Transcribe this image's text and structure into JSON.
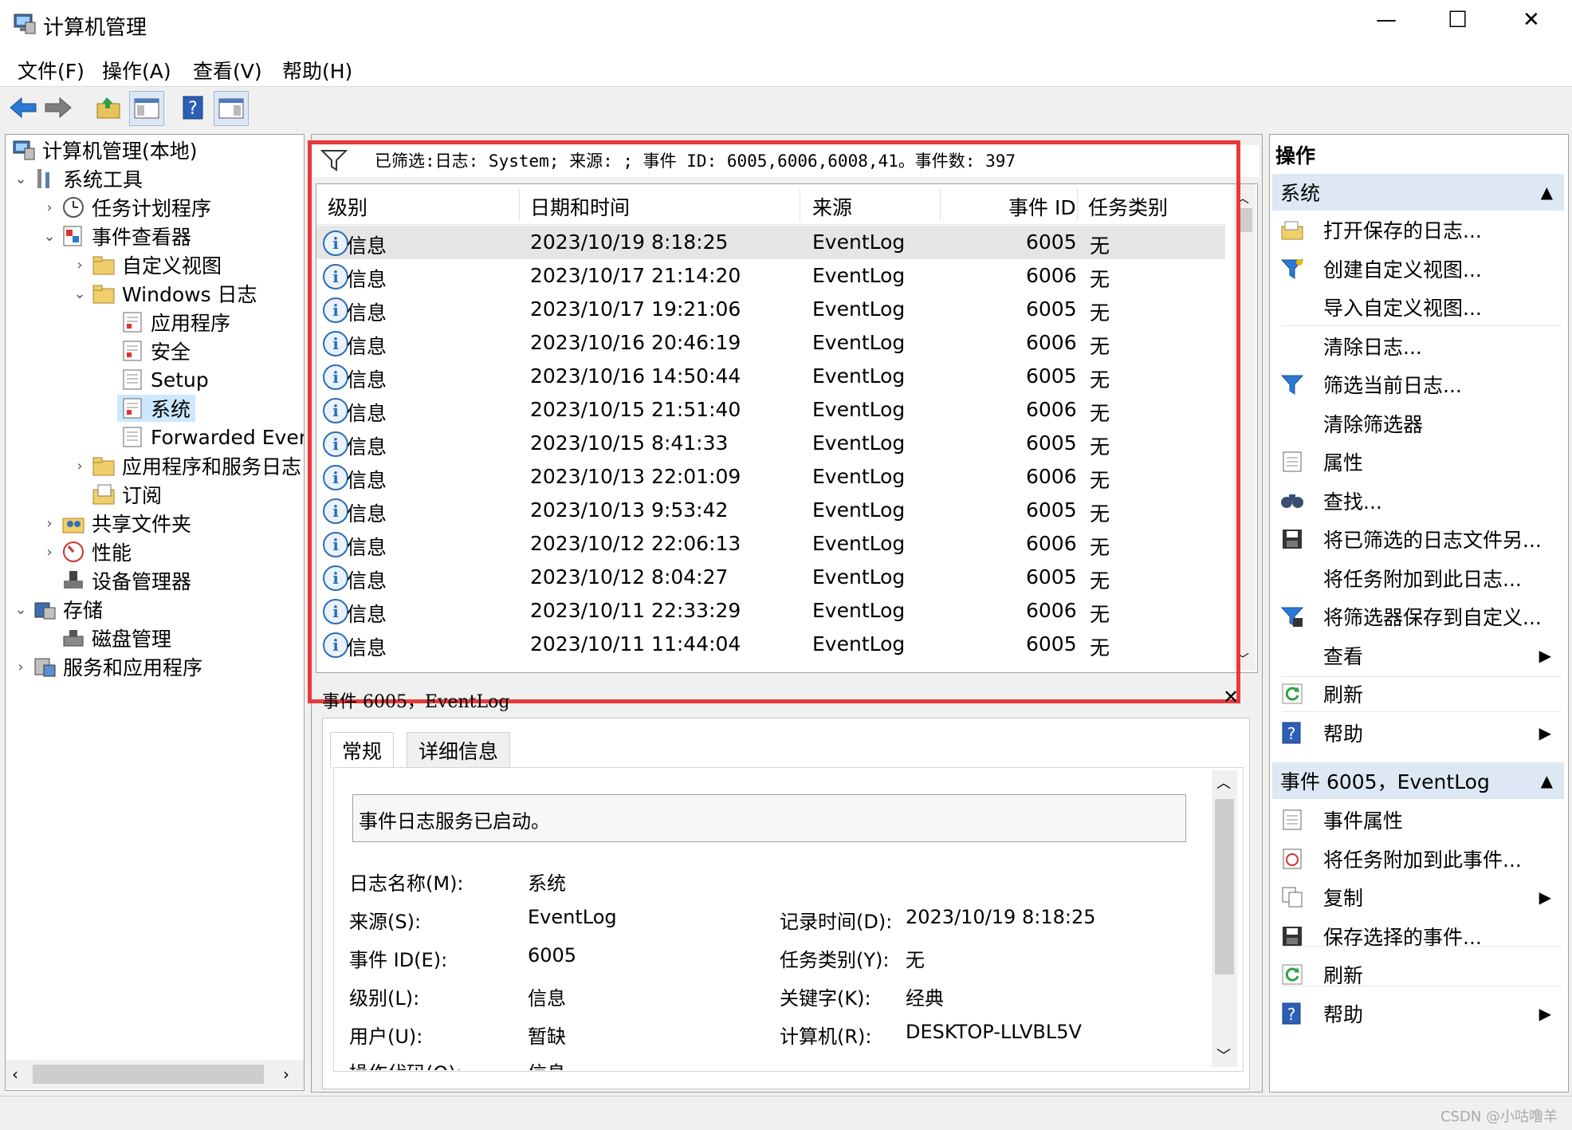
{
  "window": {
    "title": "计算机管理",
    "controls": {
      "minimize": "—",
      "maximize": "☐",
      "close": "✕"
    }
  },
  "menu": [
    "文件(F)",
    "操作(A)",
    "查看(V)",
    "帮助(H)"
  ],
  "toolbar": [
    "back-icon",
    "forward-icon",
    "up-folder-icon",
    "show-hide-tree-icon",
    "help-icon",
    "show-hide-action-icon"
  ],
  "tree": [
    {
      "label": "计算机管理(本地)",
      "icon": "computer-management-icon"
    },
    {
      "label": "系统工具",
      "icon": "tools-icon"
    },
    {
      "label": "任务计划程序",
      "icon": "clock-icon"
    },
    {
      "label": "事件查看器",
      "icon": "event-viewer-icon"
    },
    {
      "label": "自定义视图",
      "icon": "folder-icon"
    },
    {
      "label": "Windows 日志",
      "icon": "folder-icon"
    },
    {
      "label": "应用程序",
      "icon": "log-icon"
    },
    {
      "label": "安全",
      "icon": "log-icon"
    },
    {
      "label": "Setup",
      "icon": "log-icon"
    },
    {
      "label": "系统",
      "icon": "log-icon"
    },
    {
      "label": "Forwarded Even",
      "icon": "log-icon"
    },
    {
      "label": "应用程序和服务日志",
      "icon": "folder-icon"
    },
    {
      "label": "订阅",
      "icon": "subscription-icon"
    },
    {
      "label": "共享文件夹",
      "icon": "shared-folder-icon"
    },
    {
      "label": "性能",
      "icon": "performance-icon"
    },
    {
      "label": "设备管理器",
      "icon": "device-manager-icon"
    },
    {
      "label": "存储",
      "icon": "storage-icon"
    },
    {
      "label": "磁盘管理",
      "icon": "disk-icon"
    },
    {
      "label": "服务和应用程序",
      "icon": "services-icon"
    }
  ],
  "filter": {
    "text": "已筛选:日志: System; 来源: ; 事件 ID: 6005,6006,6008,41。事件数: 397"
  },
  "grid": {
    "headers": [
      "级别",
      "日期和时间",
      "来源",
      "事件 ID",
      "任务类别"
    ],
    "rows": [
      {
        "level": "信息",
        "datetime": "2023/10/19 8:18:25",
        "source": "EventLog",
        "id": "6005",
        "task": "无"
      },
      {
        "level": "信息",
        "datetime": "2023/10/17 21:14:20",
        "source": "EventLog",
        "id": "6006",
        "task": "无"
      },
      {
        "level": "信息",
        "datetime": "2023/10/17 19:21:06",
        "source": "EventLog",
        "id": "6005",
        "task": "无"
      },
      {
        "level": "信息",
        "datetime": "2023/10/16 20:46:19",
        "source": "EventLog",
        "id": "6006",
        "task": "无"
      },
      {
        "level": "信息",
        "datetime": "2023/10/16 14:50:44",
        "source": "EventLog",
        "id": "6005",
        "task": "无"
      },
      {
        "level": "信息",
        "datetime": "2023/10/15 21:51:40",
        "source": "EventLog",
        "id": "6006",
        "task": "无"
      },
      {
        "level": "信息",
        "datetime": "2023/10/15 8:41:33",
        "source": "EventLog",
        "id": "6005",
        "task": "无"
      },
      {
        "level": "信息",
        "datetime": "2023/10/13 22:01:09",
        "source": "EventLog",
        "id": "6006",
        "task": "无"
      },
      {
        "level": "信息",
        "datetime": "2023/10/13 9:53:42",
        "source": "EventLog",
        "id": "6005",
        "task": "无"
      },
      {
        "level": "信息",
        "datetime": "2023/10/12 22:06:13",
        "source": "EventLog",
        "id": "6006",
        "task": "无"
      },
      {
        "level": "信息",
        "datetime": "2023/10/12 8:04:27",
        "source": "EventLog",
        "id": "6005",
        "task": "无"
      },
      {
        "level": "信息",
        "datetime": "2023/10/11 22:33:29",
        "source": "EventLog",
        "id": "6006",
        "task": "无"
      },
      {
        "level": "信息",
        "datetime": "2023/10/11 11:44:04",
        "source": "EventLog",
        "id": "6005",
        "task": "无"
      }
    ]
  },
  "detail": {
    "header": "事件 6005，EventLog",
    "tabs": [
      "常规",
      "详细信息"
    ],
    "description": "事件日志服务已启动。",
    "fields": {
      "log_name_label": "日志名称(M):",
      "log_name": "系统",
      "source_label": "来源(S):",
      "source": "EventLog",
      "logged_label": "记录时间(D):",
      "logged": "2023/10/19 8:18:25",
      "event_id_label": "事件 ID(E):",
      "event_id": "6005",
      "task_label": "任务类别(Y):",
      "task": "无",
      "level_label": "级别(L):",
      "level": "信息",
      "keywords_label": "关键字(K):",
      "keywords": "经典",
      "user_label": "用户(U):",
      "user": "暂缺",
      "computer_label": "计算机(R):",
      "computer": "DESKTOP-LLVBL5V",
      "opcode_label": "操作代码(O):",
      "opcode": "信息"
    }
  },
  "actions": {
    "title": "操作",
    "section1": "系统",
    "items1": [
      {
        "label": "打开保存的日志...",
        "icon": "open-log-icon"
      },
      {
        "label": "创建自定义视图...",
        "icon": "filter-create-icon"
      },
      {
        "label": "导入自定义视图...",
        "icon": ""
      },
      {
        "label": "清除日志...",
        "icon": ""
      },
      {
        "label": "筛选当前日志...",
        "icon": "filter-icon"
      },
      {
        "label": "清除筛选器",
        "icon": ""
      },
      {
        "label": "属性",
        "icon": "properties-icon"
      },
      {
        "label": "查找...",
        "icon": "find-icon"
      },
      {
        "label": "将已筛选的日志文件另...",
        "icon": "save-icon"
      },
      {
        "label": "将任务附加到此日志...",
        "icon": ""
      },
      {
        "label": "将筛选器保存到自定义...",
        "icon": "filter-save-icon"
      },
      {
        "label": "查看",
        "icon": "",
        "submenu": true
      },
      {
        "label": "刷新",
        "icon": "refresh-icon"
      },
      {
        "label": "帮助",
        "icon": "help-icon",
        "submenu": true
      }
    ],
    "section2": "事件 6005，EventLog",
    "items2": [
      {
        "label": "事件属性",
        "icon": "properties-icon"
      },
      {
        "label": "将任务附加到此事件...",
        "icon": "task-icon"
      },
      {
        "label": "复制",
        "icon": "copy-icon",
        "submenu": true
      },
      {
        "label": "保存选择的事件...",
        "icon": "save-icon"
      },
      {
        "label": "刷新",
        "icon": "refresh-icon"
      },
      {
        "label": "帮助",
        "icon": "help-icon",
        "submenu": true
      }
    ]
  },
  "watermark": "CSDN @小咕噜羊",
  "colors": {
    "highlight": "#e83a3a",
    "selection": "#cce8ff",
    "section_header": "#dde8f4"
  }
}
